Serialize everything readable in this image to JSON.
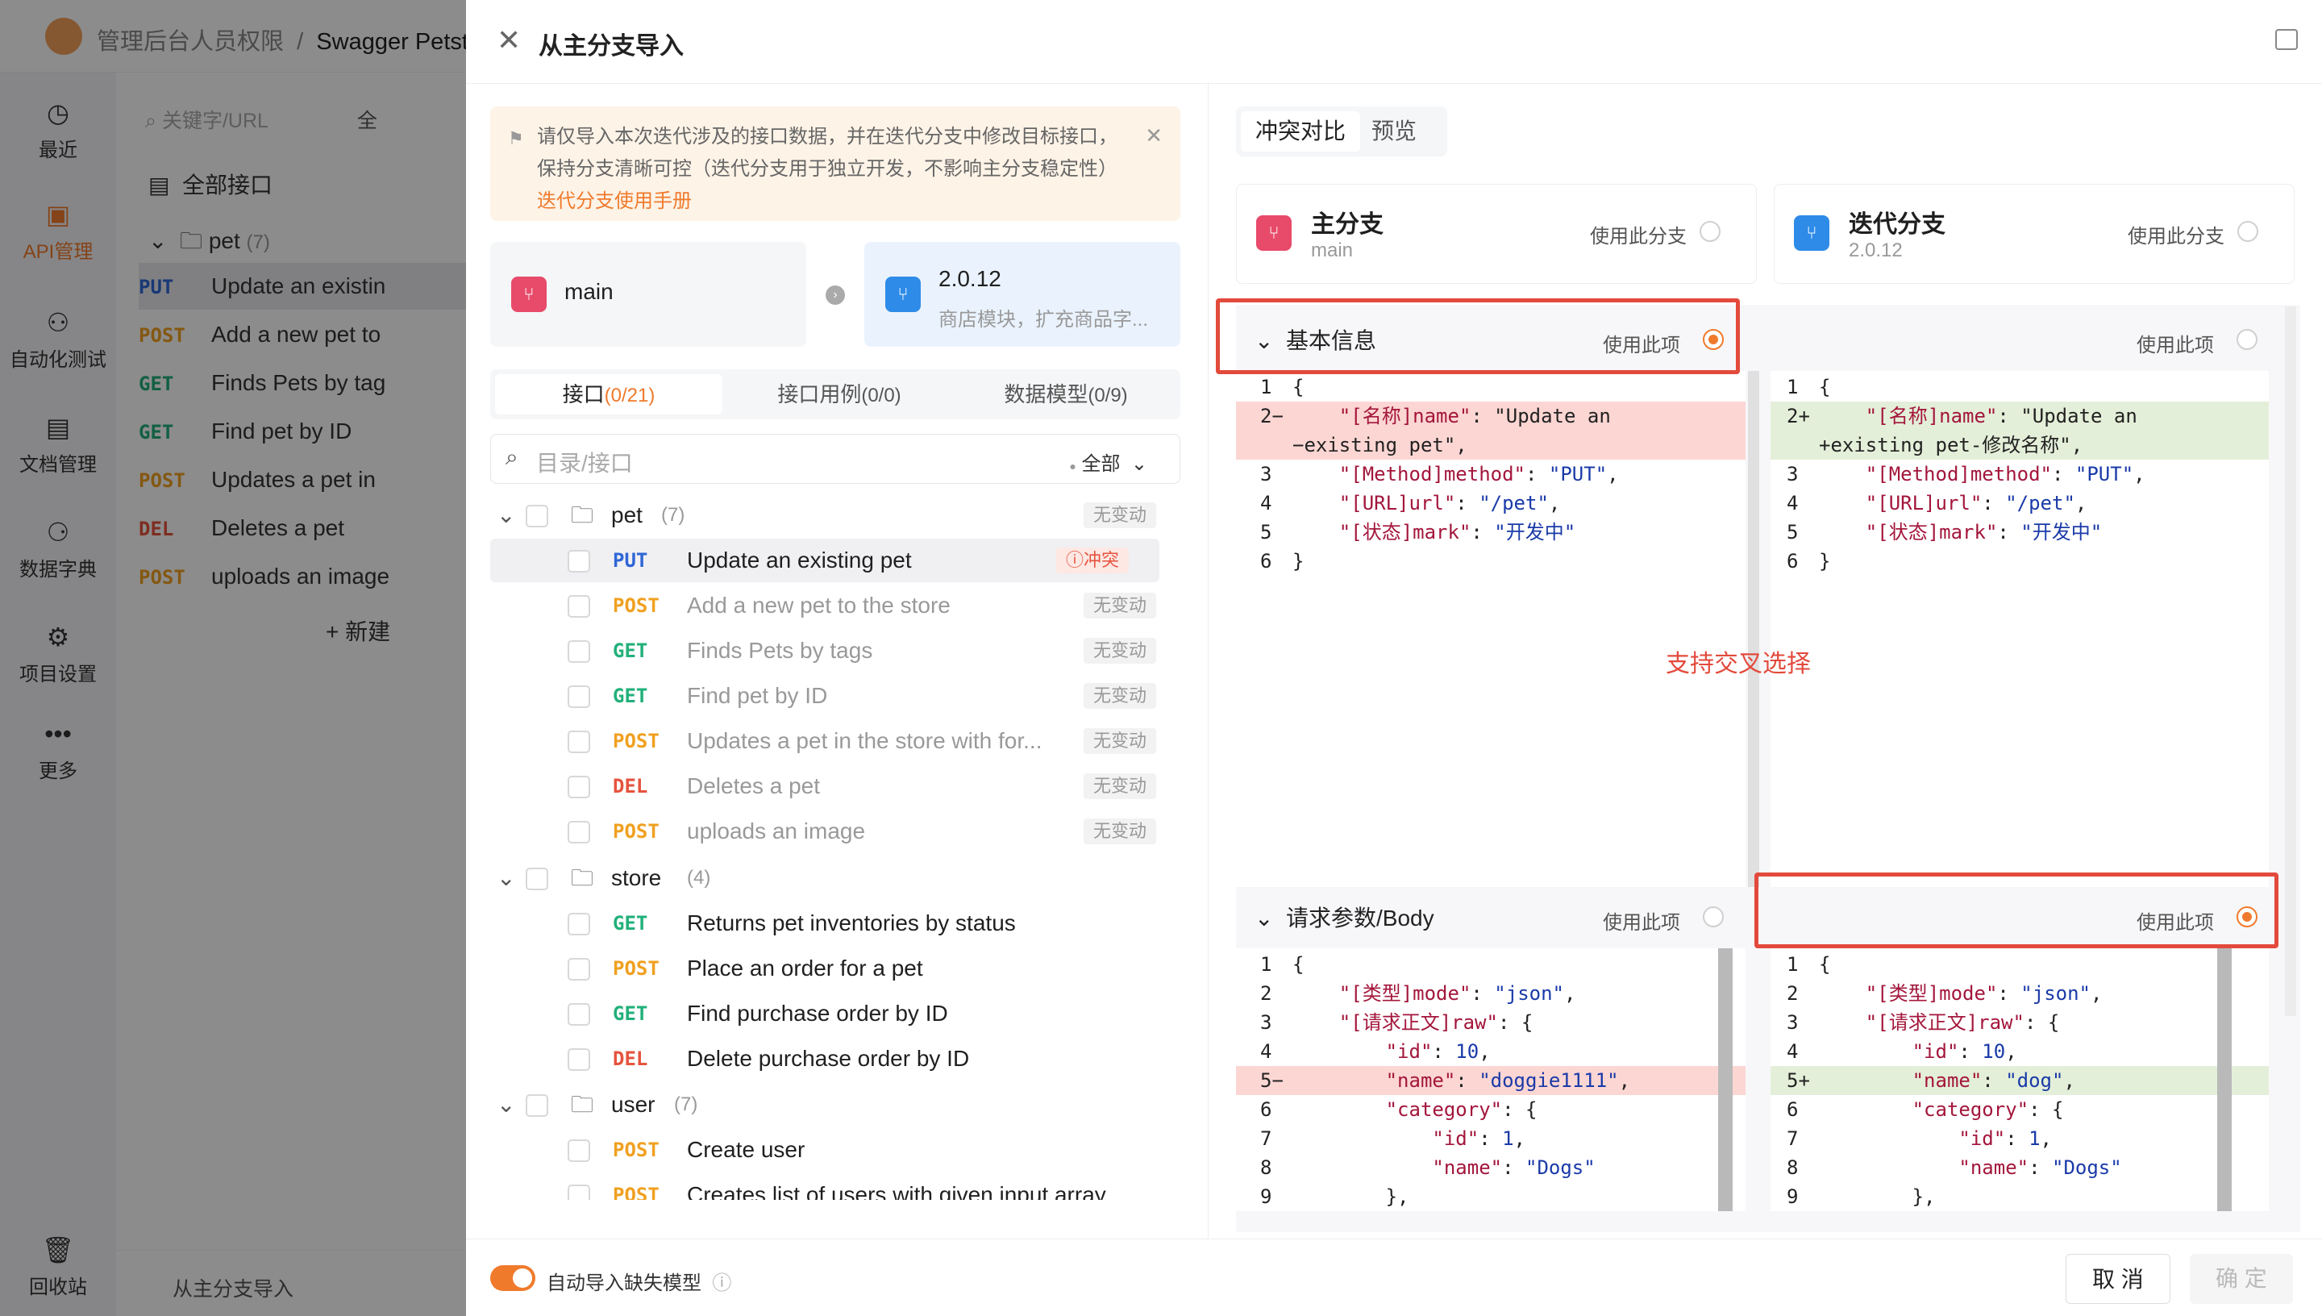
{
  "app": {
    "breadcrumb_project": "管理后台人员权限",
    "breadcrumb_sep": "/",
    "breadcrumb_page": "Swagger Petsto"
  },
  "leftnav": [
    {
      "label": "最近",
      "icon": "clock-icon",
      "glyph": "◷"
    },
    {
      "label": "API管理",
      "icon": "api-icon",
      "glyph": "▣"
    },
    {
      "label": "自动化测试",
      "icon": "automation-icon",
      "glyph": "⚇"
    },
    {
      "label": "文档管理",
      "icon": "doc-icon",
      "glyph": "▤"
    },
    {
      "label": "数据字典",
      "icon": "dictionary-icon",
      "glyph": "⚆"
    },
    {
      "label": "项目设置",
      "icon": "settings-icon",
      "glyph": "⚙"
    },
    {
      "label": "更多",
      "icon": "more-icon",
      "glyph": "•••"
    },
    {
      "label": "回收站",
      "icon": "trash-icon",
      "glyph": "🗑"
    }
  ],
  "bg": {
    "search_placeholder": "关键字/URL",
    "filter": "全",
    "all_apis": "全部接口",
    "folder": "pet",
    "folder_count": "(7)",
    "rows": [
      {
        "method": "PUT",
        "name": "Update an existin"
      },
      {
        "method": "POST",
        "name": "Add a new pet to"
      },
      {
        "method": "GET",
        "name": "Finds Pets by tag"
      },
      {
        "method": "GET",
        "name": "Find pet by ID"
      },
      {
        "method": "POST",
        "name": "Updates a pet in"
      },
      {
        "method": "DEL",
        "name": "Deletes a pet"
      },
      {
        "method": "POST",
        "name": "uploads an image"
      }
    ],
    "new_label": "+ 新建",
    "bottom_label": "从主分支导入"
  },
  "drawer": {
    "title": "从主分支导入",
    "notice": "请仅导入本次迭代涉及的接口数据，并在迭代分支中修改目标接口，保持分支清晰可控（迭代分支用于独立开发，不影响主分支稳定性）",
    "notice_link": "迭代分支使用手册",
    "source_branch": "main",
    "target_branch": "2.0.12",
    "target_desc": "商店模块，扩充商品字...",
    "tabs": [
      {
        "label": "接口",
        "count": "(0/21)"
      },
      {
        "label": "接口用例",
        "count": "(0/0)"
      },
      {
        "label": "数据模型",
        "count": "(0/9)"
      }
    ],
    "search_placeholder": "目录/接口",
    "filter_label": "全部",
    "tree": {
      "pet": {
        "name": "pet",
        "count": "(7)",
        "badge": "无变动"
      },
      "pet_rows": [
        {
          "method": "PUT",
          "name": "Update an existing pet",
          "badge": "ⓘ冲突"
        },
        {
          "method": "POST",
          "name": "Add a new pet to the store",
          "badge": "无变动"
        },
        {
          "method": "GET",
          "name": "Finds Pets by tags",
          "badge": "无变动"
        },
        {
          "method": "GET",
          "name": "Find pet by ID",
          "badge": "无变动"
        },
        {
          "method": "POST",
          "name": "Updates a pet in the store with for...",
          "badge": "无变动"
        },
        {
          "method": "DEL",
          "name": "Deletes a pet",
          "badge": "无变动"
        },
        {
          "method": "POST",
          "name": "uploads an image",
          "badge": "无变动"
        }
      ],
      "store": {
        "name": "store",
        "count": "(4)"
      },
      "store_rows": [
        {
          "method": "GET",
          "name": "Returns pet inventories by status"
        },
        {
          "method": "POST",
          "name": "Place an order for a pet"
        },
        {
          "method": "GET",
          "name": "Find purchase order by ID"
        },
        {
          "method": "DEL",
          "name": "Delete purchase order by ID"
        }
      ],
      "user": {
        "name": "user",
        "count": "(7)"
      },
      "user_rows": [
        {
          "method": "POST",
          "name": "Create user"
        },
        {
          "method": "POST",
          "name": "Creates list of users with given input array"
        }
      ]
    },
    "footer": {
      "auto_import": "自动导入缺失模型",
      "cancel": "取 消",
      "confirm": "确 定"
    },
    "compare": {
      "tabs": [
        "冲突对比",
        "预览"
      ],
      "main_card": {
        "title": "主分支",
        "sub": "main",
        "use": "使用此分支"
      },
      "iter_card": {
        "title": "迭代分支",
        "sub": "2.0.12",
        "use": "使用此分支"
      },
      "sections": {
        "basic": "基本信息",
        "body": "请求参数/Body",
        "use": "使用此项"
      },
      "annotation": "支持交叉选择",
      "basic_left": [
        {
          "n": "1",
          "t": "{"
        },
        {
          "n": "2−",
          "t": "    \"[名称]name\": \"Update an"
        },
        {
          "n": "",
          "t": "−existing pet\","
        },
        {
          "n": "3",
          "t": "    \"[Method]method\": \"PUT\","
        },
        {
          "n": "4",
          "t": "    \"[URL]url\": \"/pet\","
        },
        {
          "n": "5",
          "t": "    \"[状态]mark\": \"开发中\""
        },
        {
          "n": "6",
          "t": "}"
        }
      ],
      "basic_right": [
        {
          "n": "1",
          "t": "{"
        },
        {
          "n": "2+",
          "t": "    \"[名称]name\": \"Update an"
        },
        {
          "n": "",
          "t": "+existing pet-修改名称\","
        },
        {
          "n": "3",
          "t": "    \"[Method]method\": \"PUT\","
        },
        {
          "n": "4",
          "t": "    \"[URL]url\": \"/pet\","
        },
        {
          "n": "5",
          "t": "    \"[状态]mark\": \"开发中\""
        },
        {
          "n": "6",
          "t": "}"
        }
      ],
      "body_left": [
        {
          "n": "1",
          "t": "{"
        },
        {
          "n": "2",
          "t": "    \"[类型]mode\": \"json\","
        },
        {
          "n": "3",
          "t": "    \"[请求正文]raw\": {"
        },
        {
          "n": "4",
          "t": "        \"id\": 10,"
        },
        {
          "n": "5−",
          "t": "        \"name\": \"doggie1111\","
        },
        {
          "n": "6",
          "t": "        \"category\": {"
        },
        {
          "n": "7",
          "t": "            \"id\": 1,"
        },
        {
          "n": "8",
          "t": "            \"name\": \"Dogs\""
        },
        {
          "n": "9",
          "t": "        },"
        }
      ],
      "body_right": [
        {
          "n": "1",
          "t": "{"
        },
        {
          "n": "2",
          "t": "    \"[类型]mode\": \"json\","
        },
        {
          "n": "3",
          "t": "    \"[请求正文]raw\": {"
        },
        {
          "n": "4",
          "t": "        \"id\": 10,"
        },
        {
          "n": "5+",
          "t": "        \"name\": \"dog\","
        },
        {
          "n": "6",
          "t": "        \"category\": {"
        },
        {
          "n": "7",
          "t": "            \"id\": 1,"
        },
        {
          "n": "8",
          "t": "            \"name\": \"Dogs\""
        },
        {
          "n": "9",
          "t": "        },"
        }
      ]
    }
  },
  "colors": {
    "accent": "#f07a2c",
    "conflict": "#e5533d",
    "removed_bg": "#fcd6d3",
    "added_bg": "#e4efd9",
    "annotation": "#e34a3c"
  }
}
